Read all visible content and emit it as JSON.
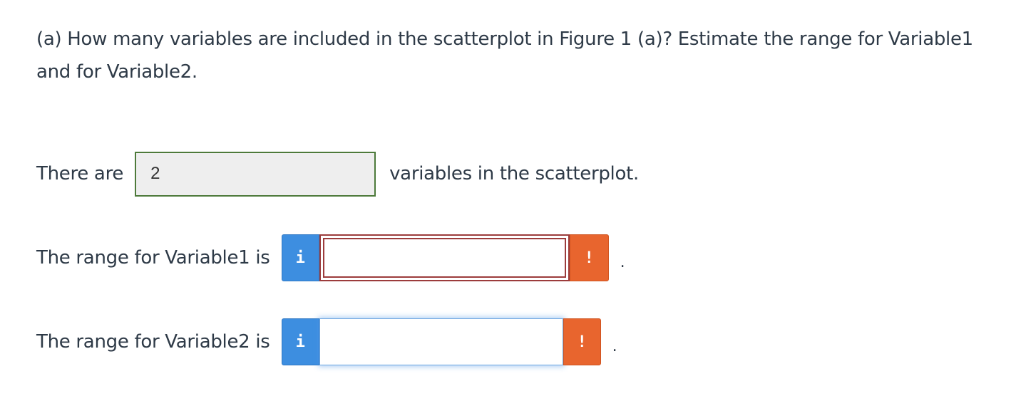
{
  "question": {
    "text": "(a) How many variables are included in the scatterplot in Figure 1 (a)? Estimate the range for Variable1 and for Variable2."
  },
  "row1": {
    "prefix": "There are",
    "answer_value": "2",
    "suffix": "variables in the scatterplot."
  },
  "row2": {
    "label": "The range for Variable1 is",
    "info_glyph": "i",
    "input_value": "",
    "warning_glyph": "!",
    "period": "."
  },
  "row3": {
    "label": "The range for Variable2 is",
    "info_glyph": "i",
    "input_value": "",
    "warning_glyph": "!",
    "period": "."
  },
  "colors": {
    "correct_border": "#4d7a3a",
    "invalid_border": "#9c3c3c",
    "info_blue": "#3d8ee0",
    "warning_orange": "#e8652e"
  },
  "icons": [
    "info-icon",
    "warning-icon"
  ]
}
